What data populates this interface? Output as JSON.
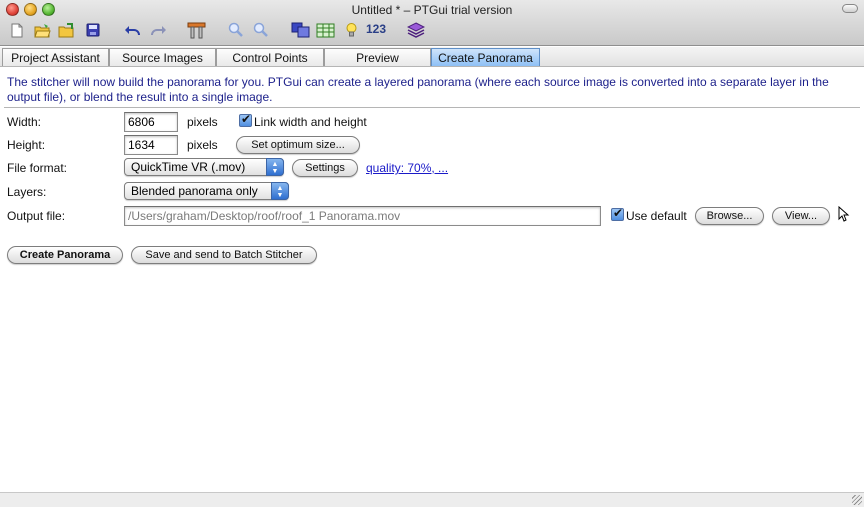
{
  "window": {
    "title": "Untitled * – PTGui trial version"
  },
  "toolbar": {
    "items": [
      {
        "name": "new-document-icon"
      },
      {
        "name": "open-project-icon"
      },
      {
        "name": "load-images-icon"
      },
      {
        "name": "save-icon"
      },
      {
        "name": "undo-icon"
      },
      {
        "name": "redo-icon"
      },
      {
        "name": "tools-icon"
      },
      {
        "name": "zoom-in-icon"
      },
      {
        "name": "zoom-out-icon"
      },
      {
        "name": "panorama-editor-icon"
      },
      {
        "name": "table-icon"
      },
      {
        "name": "lightbulb-icon"
      },
      {
        "name": "layers-icon"
      }
    ],
    "numbers_label": "123"
  },
  "tabs": [
    {
      "label": "Project Assistant"
    },
    {
      "label": "Source Images"
    },
    {
      "label": "Control Points"
    },
    {
      "label": "Preview"
    },
    {
      "label": "Create Panorama",
      "active": true
    }
  ],
  "intro_text": "The stitcher will now build the panorama for you. PTGui can create a layered panorama (where each source image is converted into a separate layer in the output file), or blend the result into a single image.",
  "form": {
    "width_label": "Width:",
    "width_value": "6806",
    "width_unit": "pixels",
    "link_label": "Link width and height",
    "link_checked": true,
    "height_label": "Height:",
    "height_value": "1634",
    "height_unit": "pixels",
    "optimum_button": "Set optimum size...",
    "format_label": "File format:",
    "format_value": "QuickTime VR (.mov)",
    "settings_button": "Settings",
    "quality_link": "quality: 70%, ...",
    "layers_label": "Layers:",
    "layers_value": "Blended panorama only",
    "output_label": "Output file:",
    "output_value": "/Users/graham/Desktop/roof/roof_1 Panorama.mov",
    "use_default_label": "Use default",
    "use_default_checked": true,
    "browse_button": "Browse...",
    "view_button": "View..."
  },
  "actions": {
    "create_button": "Create Panorama",
    "batch_button": "Save and send to Batch Stitcher"
  },
  "colors": {
    "intro_text": "#1b1f8a",
    "active_tab": "#8ec0f5",
    "link": "#1a1ac8"
  }
}
